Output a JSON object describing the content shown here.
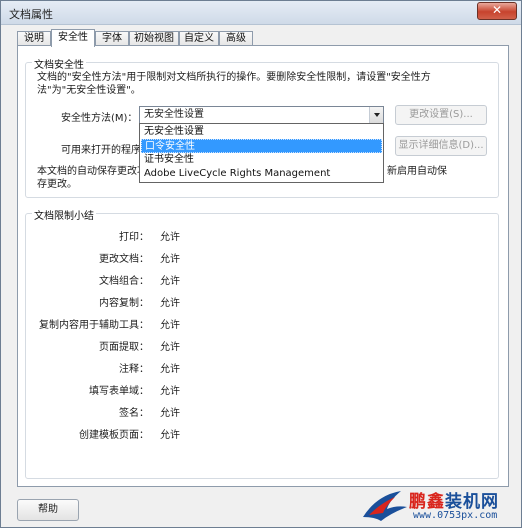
{
  "window": {
    "title": "文档属性",
    "close_label": "✕"
  },
  "tabs": [
    {
      "label": "说明"
    },
    {
      "label": "安全性"
    },
    {
      "label": "字体"
    },
    {
      "label": "初始视图"
    },
    {
      "label": "自定义"
    },
    {
      "label": "高级"
    }
  ],
  "security_group": {
    "title": "文档安全性",
    "description": "文档的\"安全性方法\"用于限制对文档所执行的操作。要删除安全性限制，请设置\"安全性方法\"为\"无安全性设置\"。",
    "method_label": "安全性方法(M)：",
    "method_value": "无安全性设置",
    "change_settings_button": "更改设置(S)...",
    "open_with_label": "可用来打开的程序：",
    "show_details_button": "显示详细信息(D)...",
    "note_left": "本文档的自动保存更改功",
    "note_right": "新启用自动保",
    "note_line2": "存更改。"
  },
  "dropdown": {
    "options": [
      {
        "label": "无安全性设置"
      },
      {
        "label": "口令安全性"
      },
      {
        "label": "证书安全性"
      },
      {
        "label": "Adobe LiveCycle Rights Management"
      }
    ],
    "highlighted": "口令安全性"
  },
  "restrictions_group": {
    "title": "文档限制小结",
    "items": [
      {
        "label": "打印：",
        "value": "允许"
      },
      {
        "label": "更改文档：",
        "value": "允许"
      },
      {
        "label": "文档组合：",
        "value": "允许"
      },
      {
        "label": "内容复制：",
        "value": "允许"
      },
      {
        "label": "复制内容用于辅助工具：",
        "value": "允许"
      },
      {
        "label": "页面提取：",
        "value": "允许"
      },
      {
        "label": "注释：",
        "value": "允许"
      },
      {
        "label": "填写表单域：",
        "value": "允许"
      },
      {
        "label": "签名：",
        "value": "允许"
      },
      {
        "label": "创建模板页面：",
        "value": "允许"
      }
    ]
  },
  "footer": {
    "help_button": "帮助"
  },
  "watermark": {
    "brand_a": "鹏鑫",
    "brand_b": "装机网",
    "url": "www.0753px.com"
  },
  "colors": {
    "highlight": "#3399ff",
    "close": "#c7432d",
    "brand_blue": "#1a4f9a",
    "brand_red": "#d9251c"
  }
}
